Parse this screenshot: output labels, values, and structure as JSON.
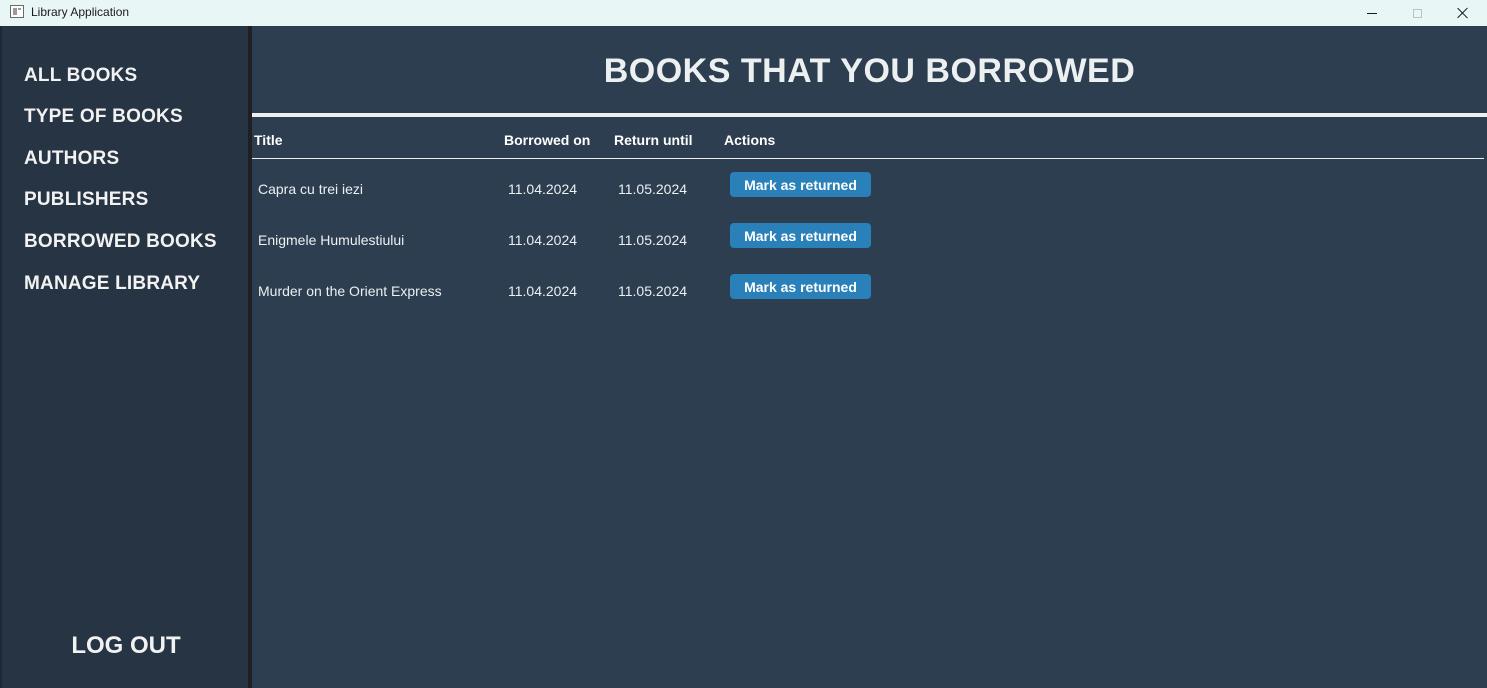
{
  "window": {
    "title": "Library Application"
  },
  "sidebar": {
    "items": [
      {
        "label": "ALL BOOKS"
      },
      {
        "label": "TYPE OF BOOKS"
      },
      {
        "label": "AUTHORS"
      },
      {
        "label": "PUBLISHERS"
      },
      {
        "label": "BORROWED BOOKS"
      },
      {
        "label": "MANAGE LIBRARY"
      }
    ],
    "logout_label": "LOG OUT"
  },
  "main": {
    "title": "BOOKS THAT YOU BORROWED",
    "columns": [
      "Title",
      "Borrowed on",
      "Return until",
      "Actions"
    ],
    "rows": [
      {
        "title": "Capra cu trei iezi",
        "borrowed_on": "11.04.2024",
        "return_until": "11.05.2024",
        "action": "Mark as returned"
      },
      {
        "title": "Enigmele Humulestiului",
        "borrowed_on": "11.04.2024",
        "return_until": "11.05.2024",
        "action": "Mark as returned"
      },
      {
        "title": "Murder on the Orient Express",
        "borrowed_on": "11.04.2024",
        "return_until": "11.05.2024",
        "action": "Mark as returned"
      }
    ]
  },
  "colors": {
    "sidebar_bg": "#263443",
    "main_bg": "#2c3e50",
    "button_bg": "#2a80b9",
    "text": "#ecf0f1"
  },
  "icons": {
    "app": "app-window-icon",
    "minimize": "minimize-icon",
    "maximize": "maximize-icon",
    "close": "close-icon"
  }
}
